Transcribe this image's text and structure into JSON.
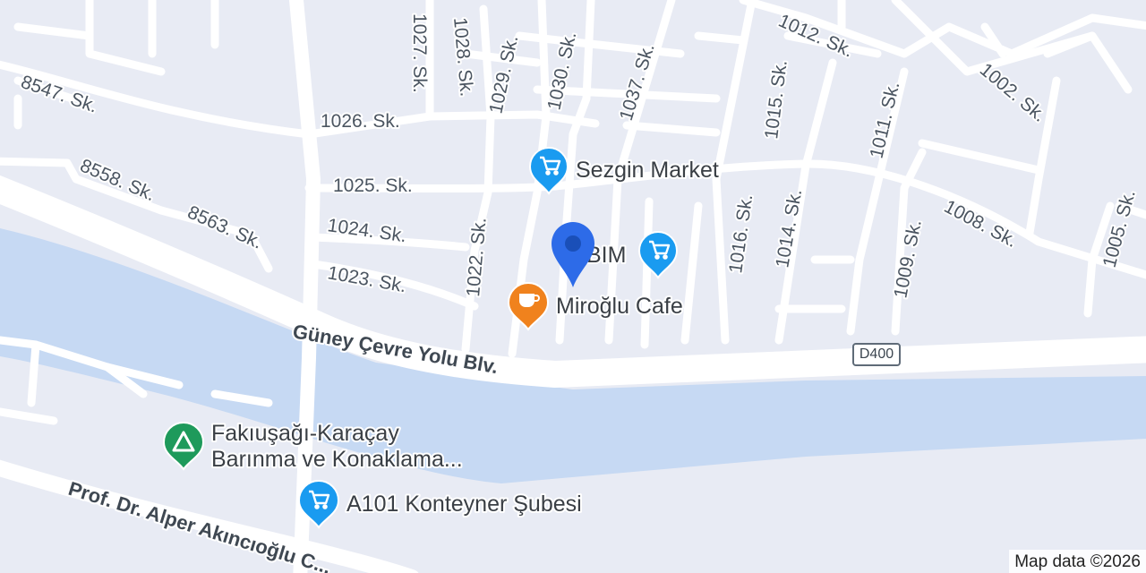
{
  "colors": {
    "land": "#e8ebf4",
    "road": "#ffffff",
    "water": "#c6d9f3",
    "shop_pin": "#1a9bf0",
    "cafe_pin": "#f0821d",
    "camp_pin": "#1e9a5b",
    "location_pin": "#2d6be8"
  },
  "streets": {
    "s8547": "8547. Sk.",
    "s1026": "1026. Sk.",
    "s1027": "1027. Sk.",
    "s1028": "1028. Sk.",
    "s1029": "1029. Sk.",
    "s1030": "1030. Sk.",
    "s1037": "1037. Sk.",
    "s1012": "1012. Sk.",
    "s1015": "1015. Sk.",
    "s1011": "1011. Sk.",
    "s1002": "1002. Sk.",
    "s8558": "8558. Sk.",
    "s8563": "8563. Sk.",
    "s1025": "1025. Sk.",
    "s1024": "1024. Sk.",
    "s1023": "1023. Sk.",
    "s1022": "1022. Sk.",
    "s1016": "1016. Sk.",
    "s1014": "1014. Sk.",
    "s1009": "1009. Sk.",
    "s1008": "1008. Sk.",
    "s1005": "1005. Sk.",
    "guney": "Güney Çevre Yolu Blv.",
    "prof": "Prof. Dr. Alper Akıncıoğlu C..."
  },
  "route_shield": "D400",
  "pois": {
    "sezgin": {
      "label": "Sezgin Market",
      "icon": "shopping-cart-icon"
    },
    "bim": {
      "label": "BIM",
      "icon": "shopping-cart-icon"
    },
    "miroglu": {
      "label": "Miroğlu Cafe",
      "icon": "coffee-cup-icon"
    },
    "fakiusagi": {
      "line1": "Fakıuşağı-Karaçay",
      "line2": "Barınma ve Konaklama...",
      "icon": "campground-icon"
    },
    "a101": {
      "label": "A101 Konteyner Şubesi",
      "icon": "shopping-cart-icon"
    }
  },
  "location_marker": {
    "icon": "location-pin-icon"
  },
  "attribution": "Map data ©2026"
}
